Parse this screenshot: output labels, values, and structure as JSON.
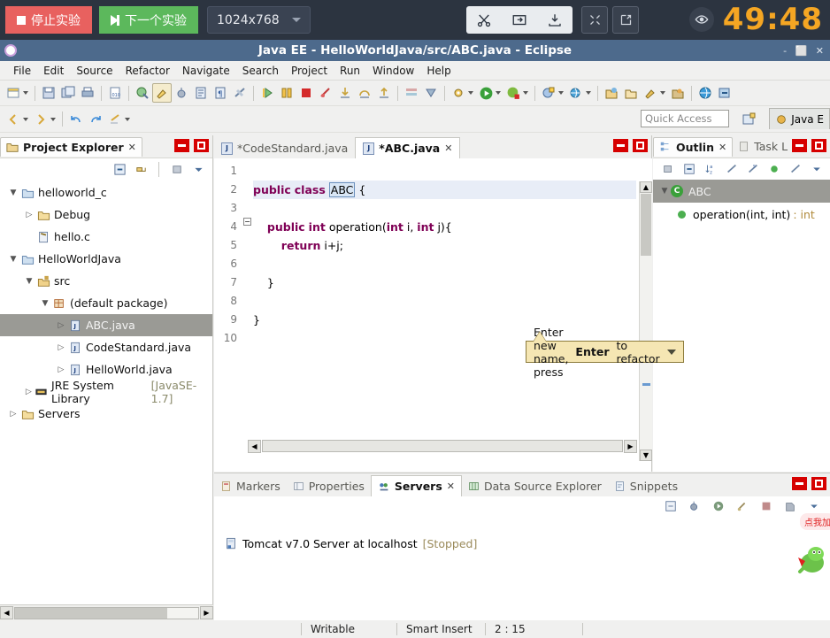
{
  "experiment_bar": {
    "stop_label": "停止实验",
    "next_label": "下一个实验",
    "resolution": "1024x768",
    "tools": [
      "scissors-icon",
      "screenshot-icon",
      "download-icon"
    ],
    "tools2": [
      "collapse-icon",
      "external-link-icon"
    ],
    "timer": "49:48",
    "timer_color": "#f5a623",
    "stop_color": "#e8615f",
    "next_color": "#5cb85c",
    "bar_color": "#2c3440"
  },
  "window": {
    "title": "Java EE - HelloWorldJava/src/ABC.java - Eclipse",
    "controls": "- ⬜ ✕"
  },
  "menu": [
    {
      "label": "File"
    },
    {
      "label": "Edit"
    },
    {
      "label": "Source"
    },
    {
      "label": "Refactor"
    },
    {
      "label": "Navigate"
    },
    {
      "label": "Search"
    },
    {
      "label": "Project"
    },
    {
      "label": "Run"
    },
    {
      "label": "Window"
    },
    {
      "label": "Help"
    }
  ],
  "toolbar2": {
    "quick_access_placeholder": "Quick Access",
    "perspective_label": "Java E"
  },
  "project_explorer": {
    "tab_label": "Project Explorer",
    "tab_close": "✕",
    "tree": [
      {
        "label": "helloworld_c",
        "indent": 0,
        "twist": "▼",
        "icon": "project-folder-icon",
        "selected": false,
        "suffix": ""
      },
      {
        "label": "Debug",
        "indent": 1,
        "twist": "▷",
        "icon": "folder-icon",
        "selected": false,
        "suffix": ""
      },
      {
        "label": "hello.c",
        "indent": 1,
        "twist": "",
        "icon": "c-file-icon",
        "selected": false,
        "suffix": ""
      },
      {
        "label": "HelloWorldJava",
        "indent": 0,
        "twist": "▼",
        "icon": "project-folder-icon",
        "selected": false,
        "suffix": ""
      },
      {
        "label": "src",
        "indent": 1,
        "twist": "▼",
        "icon": "source-folder-icon",
        "selected": false,
        "suffix": ""
      },
      {
        "label": "(default package)",
        "indent": 2,
        "twist": "▼",
        "icon": "package-icon",
        "selected": false,
        "suffix": ""
      },
      {
        "label": "ABC.java",
        "indent": 3,
        "twist": "▷",
        "icon": "java-file-icon",
        "selected": true,
        "suffix": ""
      },
      {
        "label": "CodeStandard.java",
        "indent": 3,
        "twist": "▷",
        "icon": "java-file-icon",
        "selected": false,
        "suffix": ""
      },
      {
        "label": "HelloWorld.java",
        "indent": 3,
        "twist": "▷",
        "icon": "java-file-icon",
        "selected": false,
        "suffix": ""
      },
      {
        "label": "JRE System Library",
        "indent": 1,
        "twist": "▷",
        "icon": "library-icon",
        "selected": false,
        "suffix": "[JavaSE-1.7]"
      },
      {
        "label": "Servers",
        "indent": 0,
        "twist": "▷",
        "icon": "folder-icon",
        "selected": false,
        "suffix": ""
      }
    ]
  },
  "editor": {
    "tabs": [
      {
        "label": "*CodeStandard.java",
        "active": false,
        "close": ""
      },
      {
        "label": "*ABC.java",
        "active": true,
        "close": "✕"
      }
    ],
    "line_numbers": [
      "1",
      "2",
      "3",
      "4",
      "5",
      "6",
      "7",
      "8",
      "9",
      "10"
    ],
    "lines": [
      {
        "n": 1,
        "text": "",
        "highlight": false
      },
      {
        "n": 2,
        "text": "public class ABC {",
        "highlight": true
      },
      {
        "n": 3,
        "text": "",
        "highlight": false
      },
      {
        "n": 4,
        "text": "    public int operation(int i, int j){",
        "highlight": false
      },
      {
        "n": 5,
        "text": "        return i+j;",
        "highlight": false
      },
      {
        "n": 6,
        "text": "",
        "highlight": false
      },
      {
        "n": 7,
        "text": "    }",
        "highlight": false
      },
      {
        "n": 8,
        "text": "",
        "highlight": false
      },
      {
        "n": 9,
        "text": "}",
        "highlight": false
      },
      {
        "n": 10,
        "text": "",
        "highlight": false
      }
    ],
    "selected_identifier": "ABC",
    "rename_tooltip": {
      "prefix": "Enter new name, press ",
      "bold": "Enter",
      "suffix": " to refactor"
    }
  },
  "outline": {
    "tabs": [
      {
        "label": "Outlin",
        "active": true,
        "close": "✕"
      },
      {
        "label": "Task L",
        "active": false,
        "close": ""
      }
    ],
    "items": [
      {
        "label": "ABC",
        "icon": "class-icon",
        "indent": 0,
        "selected": true,
        "type": ""
      },
      {
        "label": "operation(int, int)",
        "icon": "method-icon",
        "indent": 1,
        "selected": false,
        "type": ": int"
      }
    ]
  },
  "bottom": {
    "tabs": [
      {
        "label": "Markers",
        "icon": "markers-icon",
        "active": false,
        "close": ""
      },
      {
        "label": "Properties",
        "icon": "properties-icon",
        "active": false,
        "close": ""
      },
      {
        "label": "Servers",
        "icon": "servers-icon",
        "active": true,
        "close": "✕"
      },
      {
        "label": "Data Source Explorer",
        "icon": "datasource-icon",
        "active": false,
        "close": ""
      },
      {
        "label": "Snippets",
        "icon": "snippets-icon",
        "active": false,
        "close": ""
      }
    ],
    "server": {
      "name": "Tomcat v7.0 Server at localhost",
      "status": "[Stopped]",
      "status_color": "#9a8a5a"
    }
  },
  "status_bar": {
    "writable": "Writable",
    "insert_mode": "Smart Insert",
    "position": "2 : 15"
  },
  "float_widget": {
    "bubble_text": "点我加",
    "char_icon": "mascot-icon"
  }
}
